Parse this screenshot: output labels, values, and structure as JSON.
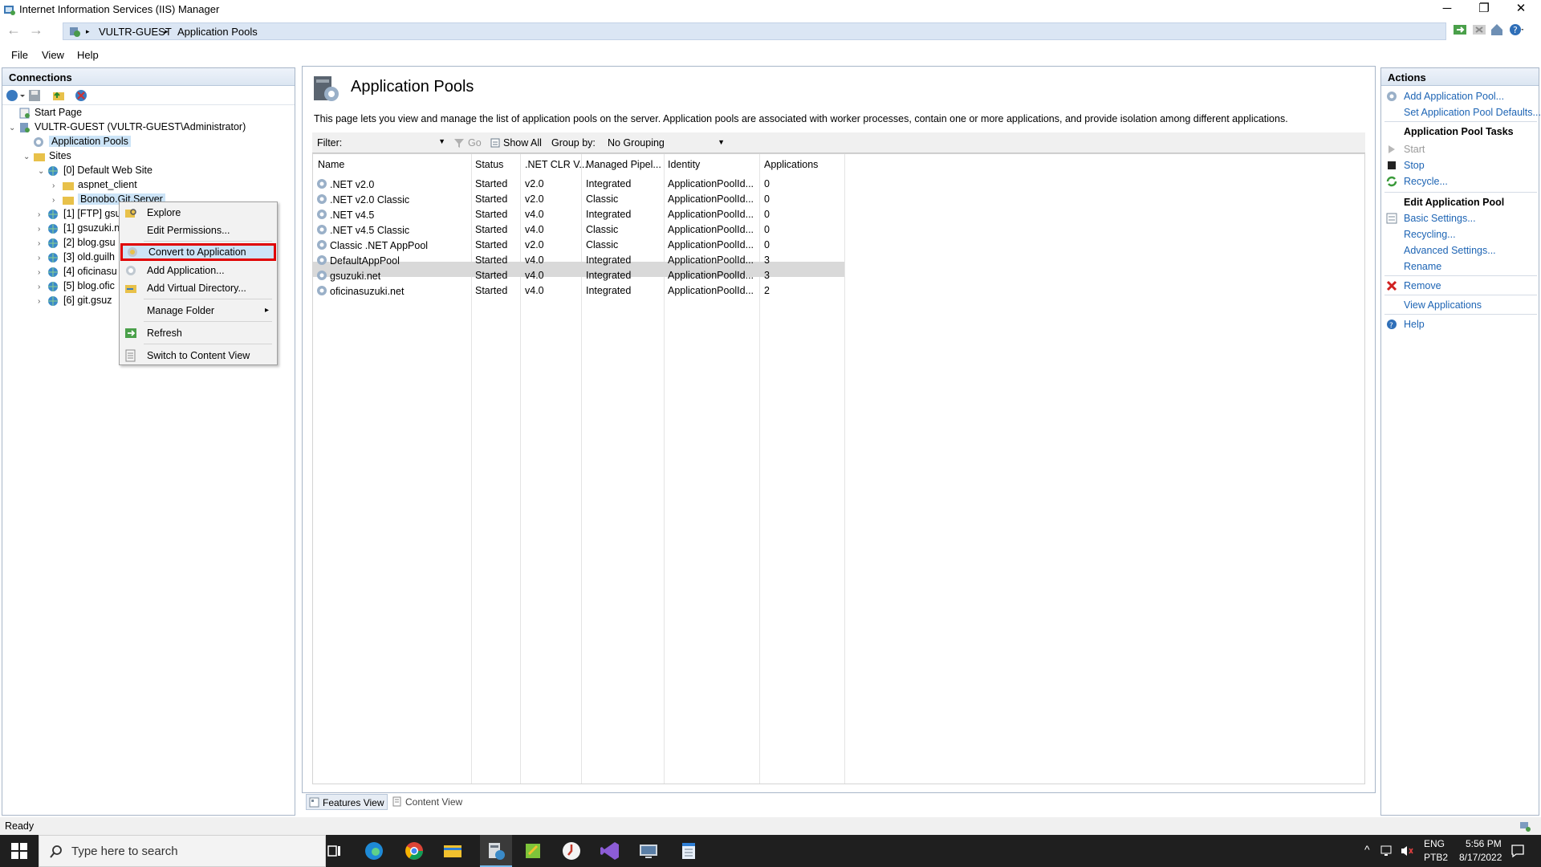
{
  "window": {
    "title": "Internet Information Services (IIS) Manager",
    "minimize": "─",
    "restore": "❐",
    "close": "✕"
  },
  "address": {
    "back": "←",
    "forward": "→",
    "crumbs": [
      "VULTR-GUEST",
      "Application Pools"
    ],
    "separator": "▸"
  },
  "menu": [
    "File",
    "View",
    "Help"
  ],
  "connections": {
    "title": "Connections",
    "tree": [
      {
        "label": "Start Page"
      },
      {
        "label": "VULTR-GUEST (VULTR-GUEST\\Administrator)"
      },
      {
        "label": "Application Pools"
      },
      {
        "label": "Sites"
      },
      {
        "label": "[0] Default Web Site"
      },
      {
        "label": "aspnet_client"
      },
      {
        "label": "Bonobo.Git.Server"
      },
      {
        "label": "[1] [FTP] gsu"
      },
      {
        "label": "[1] gsuzuki.n"
      },
      {
        "label": "[2] blog.gsu"
      },
      {
        "label": "[3] old.guilh"
      },
      {
        "label": "[4] oficinasu"
      },
      {
        "label": "[5] blog.ofic"
      },
      {
        "label": "[6] git.gsuz"
      }
    ]
  },
  "context_menu": {
    "items": [
      "Explore",
      "Edit Permissions...",
      "Convert to Application",
      "Add Application...",
      "Add Virtual Directory...",
      "Manage Folder",
      "Refresh",
      "Switch to Content View"
    ],
    "submenu_arrow": "▸"
  },
  "center": {
    "title": "Application Pools",
    "description": "This page lets you view and manage the list of application pools on the server. Application pools are associated with worker processes, contain one or more applications, and provide isolation among different applications.",
    "filter_label": "Filter:",
    "go_label": "Go",
    "show_all_label": "Show All",
    "group_by_label": "Group by:",
    "group_by_value": "No Grouping",
    "columns": [
      "Name",
      "Status",
      ".NET CLR V...",
      "Managed Pipel...",
      "Identity",
      "Applications"
    ],
    "rows": [
      {
        "name": ".NET v2.0",
        "status": "Started",
        "clr": "v2.0",
        "pipeline": "Integrated",
        "identity": "ApplicationPoolId...",
        "apps": "0"
      },
      {
        "name": ".NET v2.0 Classic",
        "status": "Started",
        "clr": "v2.0",
        "pipeline": "Classic",
        "identity": "ApplicationPoolId...",
        "apps": "0"
      },
      {
        "name": ".NET v4.5",
        "status": "Started",
        "clr": "v4.0",
        "pipeline": "Integrated",
        "identity": "ApplicationPoolId...",
        "apps": "0"
      },
      {
        "name": ".NET v4.5 Classic",
        "status": "Started",
        "clr": "v4.0",
        "pipeline": "Classic",
        "identity": "ApplicationPoolId...",
        "apps": "0"
      },
      {
        "name": "Classic .NET AppPool",
        "status": "Started",
        "clr": "v2.0",
        "pipeline": "Classic",
        "identity": "ApplicationPoolId...",
        "apps": "0"
      },
      {
        "name": "DefaultAppPool",
        "status": "Started",
        "clr": "v4.0",
        "pipeline": "Integrated",
        "identity": "ApplicationPoolId...",
        "apps": "3"
      },
      {
        "name": "gsuzuki.net",
        "status": "Started",
        "clr": "v4.0",
        "pipeline": "Integrated",
        "identity": "ApplicationPoolId...",
        "apps": "3"
      },
      {
        "name": "oficinasuzuki.net",
        "status": "Started",
        "clr": "v4.0",
        "pipeline": "Integrated",
        "identity": "ApplicationPoolId...",
        "apps": "2"
      }
    ],
    "features_view": "Features View",
    "content_view": "Content View"
  },
  "actions": {
    "title": "Actions",
    "add_pool": "Add Application Pool...",
    "set_defaults": "Set Application Pool Defaults...",
    "tasks_header": "Application Pool Tasks",
    "start": "Start",
    "stop": "Stop",
    "recycle": "Recycle...",
    "edit_header": "Edit Application Pool",
    "basic_settings": "Basic Settings...",
    "recycling": "Recycling...",
    "advanced_settings": "Advanced Settings...",
    "rename": "Rename",
    "remove": "Remove",
    "view_apps": "View Applications",
    "help": "Help"
  },
  "status": {
    "text": "Ready"
  },
  "taskbar": {
    "search_placeholder": "Type here to search",
    "lang": "ENG",
    "layout": "PTB2",
    "time": "5:56 PM",
    "date": "8/17/2022"
  },
  "colors": {
    "accent": "#1d64b4",
    "highlight_border": "#e00000",
    "taskbar": "#1f1f1f"
  }
}
